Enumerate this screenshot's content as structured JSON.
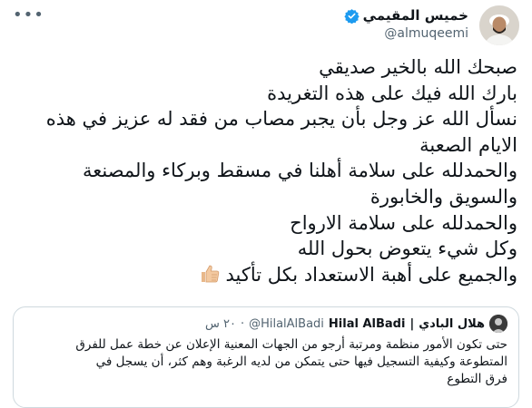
{
  "author": {
    "name": "خميس المقيمي",
    "handle": "@almuqeemi"
  },
  "tweet": {
    "lines": [
      "صبحك الله بالخير صديقي",
      "بارك الله فيك على هذه التغريدة",
      "نسأل الله عز وجل بأن يجبر مصاب من فقد له عزيز في هذه",
      "الايام الصعبة",
      "والحمدلله على سلامة أهلنا في مسقط وبركاء والمصنعة",
      "والسويق والخابورة",
      "والحمدلله على سلامة الارواح",
      "وكل شيء يتعوض بحول الله",
      "والجميع على أهبة الاستعداد بكل تأكيد"
    ]
  },
  "quoted": {
    "name_ar": "هلال البادي",
    "separator": "|",
    "name_en": "Hilal AlBadi",
    "handle": "@HilalAlBadi",
    "dot": "·",
    "time": "٢٠ س",
    "lines": [
      "حتى تكون الأمور منظمة ومرتبة أرجو من الجهات المعنية الإعلان عن خطة عمل للفرق",
      "المتطوعة وكيفية التسجيل فيها حتى يتمكن من لديه الرغبة وهم كثر، أن يسجل في",
      "فرق التطوع"
    ]
  },
  "icons": {
    "verified": "verified-badge-icon",
    "thumbs_up": "thumbs-up-emoji-icon",
    "more": "more-options-icon"
  },
  "colors": {
    "verified": "#1d9bf0",
    "text": "#0f1419",
    "secondary": "#536471",
    "border": "#cfd9de"
  }
}
